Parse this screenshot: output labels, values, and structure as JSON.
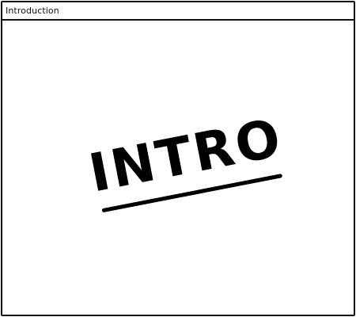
{
  "window": {
    "title": "Introduction"
  },
  "content": {
    "headline": "INTRO"
  }
}
